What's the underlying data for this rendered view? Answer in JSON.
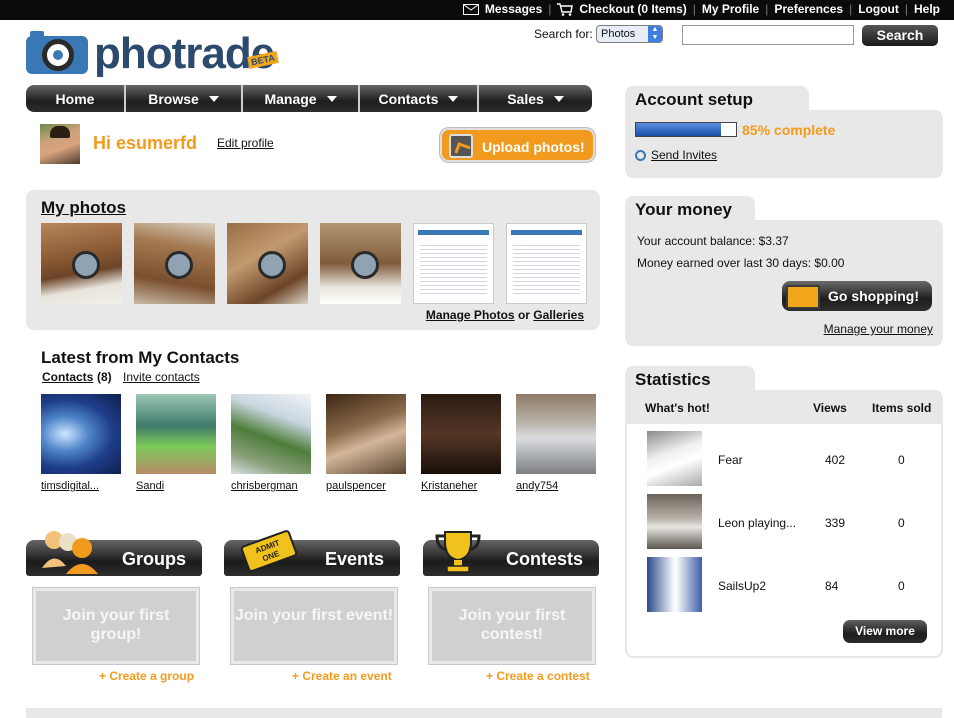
{
  "topbar": {
    "links": [
      {
        "label": "Messages",
        "icon": "envelope-icon"
      },
      {
        "label": "Checkout (0 Items)",
        "icon": "cart-icon"
      },
      {
        "label": "My Profile"
      },
      {
        "label": "Preferences"
      },
      {
        "label": "Logout"
      },
      {
        "label": "Help"
      }
    ]
  },
  "brand": {
    "name": "photrade",
    "badge": "BETA"
  },
  "search": {
    "label": "Search for:",
    "type_value": "Photos",
    "input_value": "",
    "button_label": "Search"
  },
  "nav": {
    "items": [
      {
        "label": "Home",
        "dropdown": false
      },
      {
        "label": "Browse",
        "dropdown": true
      },
      {
        "label": "Manage",
        "dropdown": true
      },
      {
        "label": "Contacts",
        "dropdown": true
      },
      {
        "label": "Sales",
        "dropdown": true
      }
    ]
  },
  "profile": {
    "greeting": "Hi esumerfd",
    "edit_label": "Edit profile",
    "upload_label": "Upload photos!"
  },
  "my_photos": {
    "title": "My photos",
    "manage_label": "Manage Photos",
    "or_label": "or",
    "galleries_label": "Galleries"
  },
  "contacts": {
    "title": "Latest from My Contacts",
    "tab_label": "Contacts",
    "count": "(8)",
    "invite_label": "Invite contacts",
    "people": [
      "timsdigital...",
      "Sandi",
      "chrisbergman",
      "paulspencer",
      "Kristaneher",
      "andy754"
    ]
  },
  "widgets": [
    {
      "title": "Groups",
      "empty_text": "Join your first group!",
      "link": "+ Create a group",
      "icon": "people-icon"
    },
    {
      "title": "Events",
      "empty_text": "Join your first event!",
      "link": "+ Create an event",
      "icon": "ticket-icon"
    },
    {
      "title": "Contests",
      "empty_text": "Join your first contest!",
      "link": "+ Create a contest",
      "icon": "trophy-icon"
    }
  ],
  "account_setup": {
    "title": "Account setup",
    "progress_text": "85% complete",
    "progress": 0.85,
    "send_invites_label": "Send Invites"
  },
  "money": {
    "title": "Your money",
    "balance": "Your account balance: $3.37",
    "earned": "Money earned over last 30 days: $0.00",
    "shop_label": "Go shopping!",
    "manage_label": "Manage your money"
  },
  "statistics": {
    "title": "Statistics",
    "columns": [
      "What's hot!",
      "Views",
      "Items sold"
    ],
    "rows": [
      {
        "name": "Fear",
        "views": "402",
        "items_sold": "0"
      },
      {
        "name": "Leon playing...",
        "views": "339",
        "items_sold": "0"
      },
      {
        "name": "SailsUp2",
        "views": "84",
        "items_sold": "0"
      }
    ],
    "view_more_label": "View more"
  },
  "colors": {
    "accent": "#f39b1c",
    "brand_blue": "#3a78b5",
    "panel": "#e8e8e8",
    "dark_button": "#1e1e1e"
  }
}
